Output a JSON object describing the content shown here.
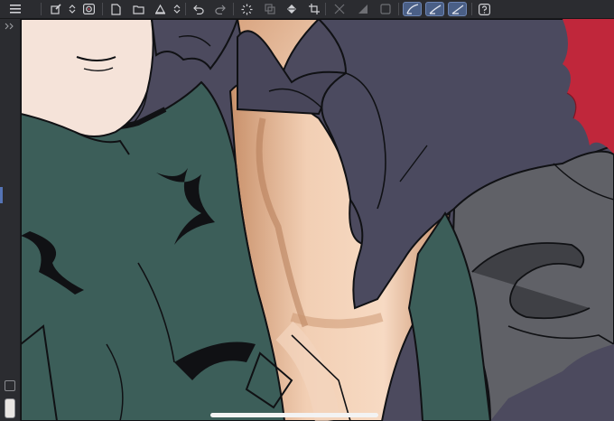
{
  "app": {
    "name": "illustration-canvas"
  },
  "toolbar": {
    "buttons": [
      {
        "name": "menu-icon",
        "active": false
      },
      {
        "name": "edit-tool-icon",
        "active": false
      },
      {
        "name": "stepper-icon",
        "active": false
      },
      {
        "name": "visibility-icon",
        "active": false
      },
      {
        "name": "new-canvas-icon",
        "active": false
      },
      {
        "name": "open-folder-icon",
        "active": false
      },
      {
        "name": "export-icon",
        "active": false
      },
      {
        "name": "stepper-icon",
        "active": false
      },
      {
        "name": "undo-icon",
        "active": false
      },
      {
        "name": "redo-icon",
        "active": false
      },
      {
        "name": "selection-spinner-icon",
        "active": false
      },
      {
        "name": "layer-icon",
        "active": false
      },
      {
        "name": "fill-bucket-icon",
        "active": false
      },
      {
        "name": "crop-icon",
        "active": false
      },
      {
        "name": "transform-icon",
        "active": false
      },
      {
        "name": "gradient-icon",
        "active": false
      },
      {
        "name": "deselect-icon",
        "active": false
      },
      {
        "name": "stroke-smooth-icon",
        "active": true
      },
      {
        "name": "stroke-medium-icon",
        "active": true
      },
      {
        "name": "stroke-sharp-icon",
        "active": true
      },
      {
        "name": "help-icon",
        "active": false
      }
    ]
  },
  "colors": {
    "toolbar_bg": "#2b2c30",
    "active_tool": "#4a5f86",
    "canvas_cloak": "#4c4a5e",
    "jacket": "#3c5e59",
    "skin_light": "#f7d9c2",
    "skin_shadow": "#c98f6a",
    "face": "#f5e3d9",
    "hair": "#c0273b",
    "armor_grey": "#5f6066",
    "outline": "#101114"
  }
}
